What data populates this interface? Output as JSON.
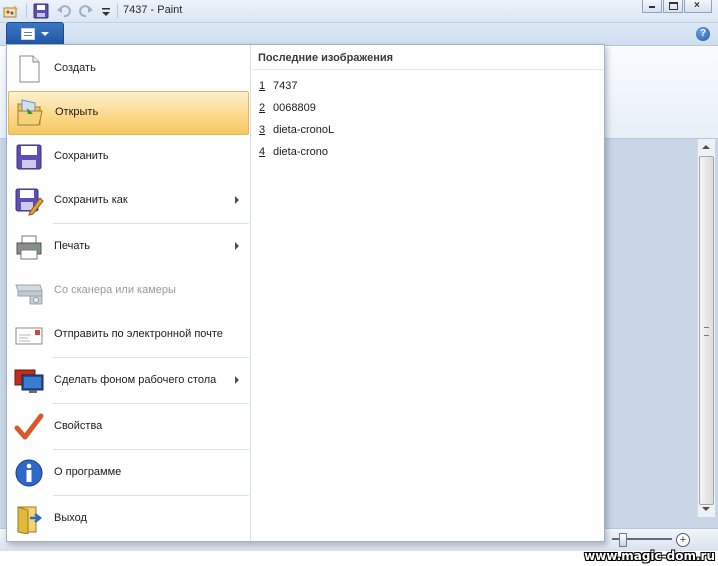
{
  "window": {
    "title": "7437 - Paint"
  },
  "quick_access": {
    "icons": [
      "paint-app-icon",
      "save-icon",
      "undo-icon",
      "redo-icon",
      "customize-dropdown-icon"
    ]
  },
  "ribbon": {
    "help_label": "?"
  },
  "app_menu": {
    "items": [
      {
        "label": "Создать",
        "icon": "new-document-icon"
      },
      {
        "label": "Открыть",
        "icon": "open-folder-icon"
      },
      {
        "label": "Сохранить",
        "icon": "save-icon"
      },
      {
        "label": "Сохранить как",
        "icon": "save-as-icon"
      },
      {
        "label": "Печать",
        "icon": "printer-icon"
      },
      {
        "label": "Со сканера или камеры",
        "icon": "scanner-icon"
      },
      {
        "label": "Отправить по электронной почте",
        "icon": "email-icon"
      },
      {
        "label": "Сделать фоном рабочего стола",
        "icon": "desktop-background-icon"
      },
      {
        "label": "Свойства",
        "icon": "checkmark-icon"
      },
      {
        "label": "О программе",
        "icon": "info-icon"
      },
      {
        "label": "Выход",
        "icon": "exit-icon"
      }
    ],
    "selected": "Открыть",
    "disabled": "Со сканера или камеры",
    "with_submenu": [
      "Сохранить как",
      "Печать",
      "Сделать фоном рабочего стола"
    ]
  },
  "recent": {
    "title": "Последние изображения",
    "items": [
      {
        "num": "1",
        "name": "7437"
      },
      {
        "num": "2",
        "name": "0068809"
      },
      {
        "num": "3",
        "name": "dieta-cronoL"
      },
      {
        "num": "4",
        "name": "dieta-crono"
      }
    ]
  },
  "statusbar": {
    "zoom_plus": "+"
  },
  "watermark": "www.magic-dom.ru"
}
